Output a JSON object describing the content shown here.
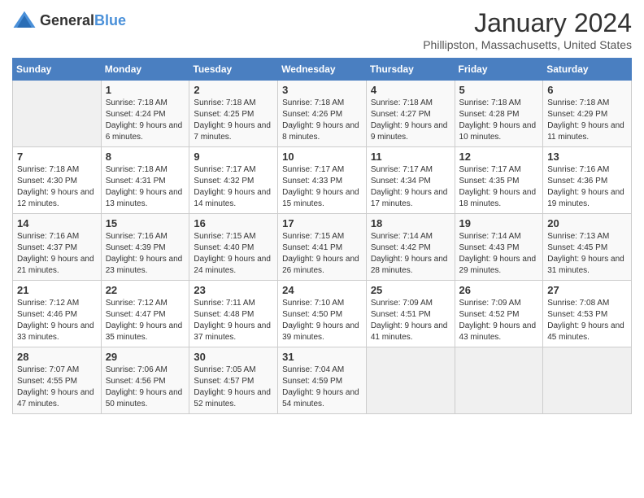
{
  "header": {
    "logo_general": "General",
    "logo_blue": "Blue",
    "main_title": "January 2024",
    "subtitle": "Phillipston, Massachusetts, United States"
  },
  "days_of_week": [
    "Sunday",
    "Monday",
    "Tuesday",
    "Wednesday",
    "Thursday",
    "Friday",
    "Saturday"
  ],
  "weeks": [
    [
      {
        "day": "",
        "sunrise": "",
        "sunset": "",
        "daylight": ""
      },
      {
        "day": "1",
        "sunrise": "Sunrise: 7:18 AM",
        "sunset": "Sunset: 4:24 PM",
        "daylight": "Daylight: 9 hours and 6 minutes."
      },
      {
        "day": "2",
        "sunrise": "Sunrise: 7:18 AM",
        "sunset": "Sunset: 4:25 PM",
        "daylight": "Daylight: 9 hours and 7 minutes."
      },
      {
        "day": "3",
        "sunrise": "Sunrise: 7:18 AM",
        "sunset": "Sunset: 4:26 PM",
        "daylight": "Daylight: 9 hours and 8 minutes."
      },
      {
        "day": "4",
        "sunrise": "Sunrise: 7:18 AM",
        "sunset": "Sunset: 4:27 PM",
        "daylight": "Daylight: 9 hours and 9 minutes."
      },
      {
        "day": "5",
        "sunrise": "Sunrise: 7:18 AM",
        "sunset": "Sunset: 4:28 PM",
        "daylight": "Daylight: 9 hours and 10 minutes."
      },
      {
        "day": "6",
        "sunrise": "Sunrise: 7:18 AM",
        "sunset": "Sunset: 4:29 PM",
        "daylight": "Daylight: 9 hours and 11 minutes."
      }
    ],
    [
      {
        "day": "7",
        "sunrise": "Sunrise: 7:18 AM",
        "sunset": "Sunset: 4:30 PM",
        "daylight": "Daylight: 9 hours and 12 minutes."
      },
      {
        "day": "8",
        "sunrise": "Sunrise: 7:18 AM",
        "sunset": "Sunset: 4:31 PM",
        "daylight": "Daylight: 9 hours and 13 minutes."
      },
      {
        "day": "9",
        "sunrise": "Sunrise: 7:17 AM",
        "sunset": "Sunset: 4:32 PM",
        "daylight": "Daylight: 9 hours and 14 minutes."
      },
      {
        "day": "10",
        "sunrise": "Sunrise: 7:17 AM",
        "sunset": "Sunset: 4:33 PM",
        "daylight": "Daylight: 9 hours and 15 minutes."
      },
      {
        "day": "11",
        "sunrise": "Sunrise: 7:17 AM",
        "sunset": "Sunset: 4:34 PM",
        "daylight": "Daylight: 9 hours and 17 minutes."
      },
      {
        "day": "12",
        "sunrise": "Sunrise: 7:17 AM",
        "sunset": "Sunset: 4:35 PM",
        "daylight": "Daylight: 9 hours and 18 minutes."
      },
      {
        "day": "13",
        "sunrise": "Sunrise: 7:16 AM",
        "sunset": "Sunset: 4:36 PM",
        "daylight": "Daylight: 9 hours and 19 minutes."
      }
    ],
    [
      {
        "day": "14",
        "sunrise": "Sunrise: 7:16 AM",
        "sunset": "Sunset: 4:37 PM",
        "daylight": "Daylight: 9 hours and 21 minutes."
      },
      {
        "day": "15",
        "sunrise": "Sunrise: 7:16 AM",
        "sunset": "Sunset: 4:39 PM",
        "daylight": "Daylight: 9 hours and 23 minutes."
      },
      {
        "day": "16",
        "sunrise": "Sunrise: 7:15 AM",
        "sunset": "Sunset: 4:40 PM",
        "daylight": "Daylight: 9 hours and 24 minutes."
      },
      {
        "day": "17",
        "sunrise": "Sunrise: 7:15 AM",
        "sunset": "Sunset: 4:41 PM",
        "daylight": "Daylight: 9 hours and 26 minutes."
      },
      {
        "day": "18",
        "sunrise": "Sunrise: 7:14 AM",
        "sunset": "Sunset: 4:42 PM",
        "daylight": "Daylight: 9 hours and 28 minutes."
      },
      {
        "day": "19",
        "sunrise": "Sunrise: 7:14 AM",
        "sunset": "Sunset: 4:43 PM",
        "daylight": "Daylight: 9 hours and 29 minutes."
      },
      {
        "day": "20",
        "sunrise": "Sunrise: 7:13 AM",
        "sunset": "Sunset: 4:45 PM",
        "daylight": "Daylight: 9 hours and 31 minutes."
      }
    ],
    [
      {
        "day": "21",
        "sunrise": "Sunrise: 7:12 AM",
        "sunset": "Sunset: 4:46 PM",
        "daylight": "Daylight: 9 hours and 33 minutes."
      },
      {
        "day": "22",
        "sunrise": "Sunrise: 7:12 AM",
        "sunset": "Sunset: 4:47 PM",
        "daylight": "Daylight: 9 hours and 35 minutes."
      },
      {
        "day": "23",
        "sunrise": "Sunrise: 7:11 AM",
        "sunset": "Sunset: 4:48 PM",
        "daylight": "Daylight: 9 hours and 37 minutes."
      },
      {
        "day": "24",
        "sunrise": "Sunrise: 7:10 AM",
        "sunset": "Sunset: 4:50 PM",
        "daylight": "Daylight: 9 hours and 39 minutes."
      },
      {
        "day": "25",
        "sunrise": "Sunrise: 7:09 AM",
        "sunset": "Sunset: 4:51 PM",
        "daylight": "Daylight: 9 hours and 41 minutes."
      },
      {
        "day": "26",
        "sunrise": "Sunrise: 7:09 AM",
        "sunset": "Sunset: 4:52 PM",
        "daylight": "Daylight: 9 hours and 43 minutes."
      },
      {
        "day": "27",
        "sunrise": "Sunrise: 7:08 AM",
        "sunset": "Sunset: 4:53 PM",
        "daylight": "Daylight: 9 hours and 45 minutes."
      }
    ],
    [
      {
        "day": "28",
        "sunrise": "Sunrise: 7:07 AM",
        "sunset": "Sunset: 4:55 PM",
        "daylight": "Daylight: 9 hours and 47 minutes."
      },
      {
        "day": "29",
        "sunrise": "Sunrise: 7:06 AM",
        "sunset": "Sunset: 4:56 PM",
        "daylight": "Daylight: 9 hours and 50 minutes."
      },
      {
        "day": "30",
        "sunrise": "Sunrise: 7:05 AM",
        "sunset": "Sunset: 4:57 PM",
        "daylight": "Daylight: 9 hours and 52 minutes."
      },
      {
        "day": "31",
        "sunrise": "Sunrise: 7:04 AM",
        "sunset": "Sunset: 4:59 PM",
        "daylight": "Daylight: 9 hours and 54 minutes."
      },
      {
        "day": "",
        "sunrise": "",
        "sunset": "",
        "daylight": ""
      },
      {
        "day": "",
        "sunrise": "",
        "sunset": "",
        "daylight": ""
      },
      {
        "day": "",
        "sunrise": "",
        "sunset": "",
        "daylight": ""
      }
    ]
  ]
}
